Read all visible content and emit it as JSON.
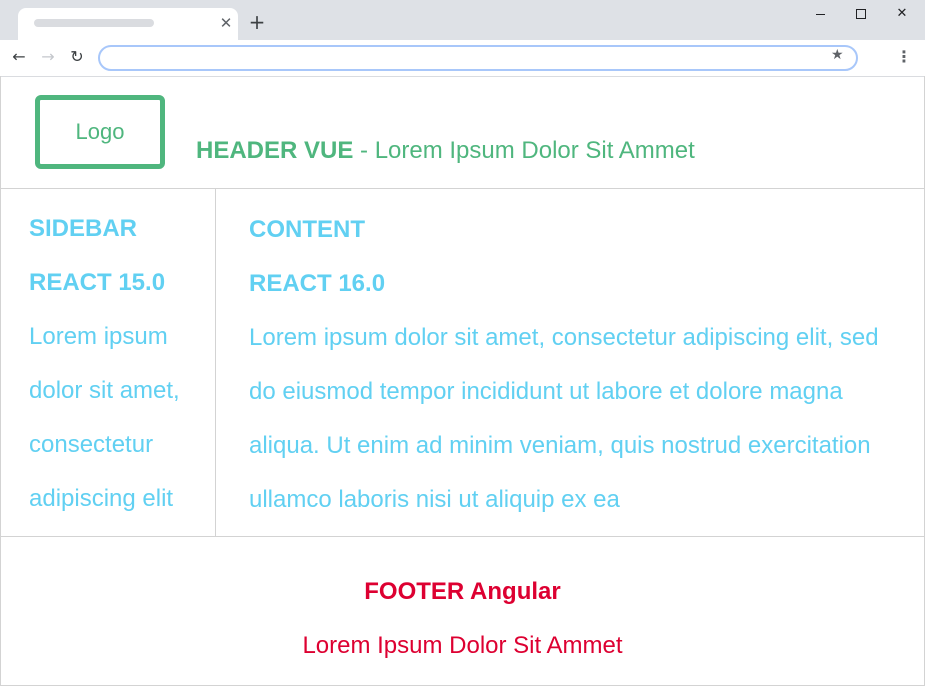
{
  "browser": {
    "tab_close_glyph": "✕",
    "new_tab_glyph": "+",
    "back_glyph": "←",
    "forward_glyph": "→",
    "reload_glyph": "↻",
    "star_glyph": "★",
    "menu_glyph": "⋮",
    "close_glyph": "✕",
    "address_value": ""
  },
  "header": {
    "logo_label": "Logo",
    "title_strong": "HEADER VUE",
    "title_rest": " - Lorem Ipsum Dolor Sit Ammet",
    "color": "#4fb67e"
  },
  "sidebar": {
    "title": "SIDEBAR",
    "subtitle": "REACT 15.0",
    "body": "Lorem ipsum dolor sit amet, consectetur adipiscing elit",
    "color": "#61d0f2"
  },
  "content": {
    "title": "CONTENT",
    "subtitle": "REACT 16.0",
    "body": "Lorem ipsum dolor sit amet, consectetur adipiscing elit, sed do eiusmod tempor incididunt ut labore et dolore magna aliqua. Ut enim ad minim veniam, quis nostrud exercitation ullamco laboris nisi ut aliquip ex ea",
    "color": "#61d0f2"
  },
  "footer": {
    "title": "FOOTER Angular",
    "text": "Lorem Ipsum Dolor Sit Ammet",
    "color": "#dd0031"
  }
}
